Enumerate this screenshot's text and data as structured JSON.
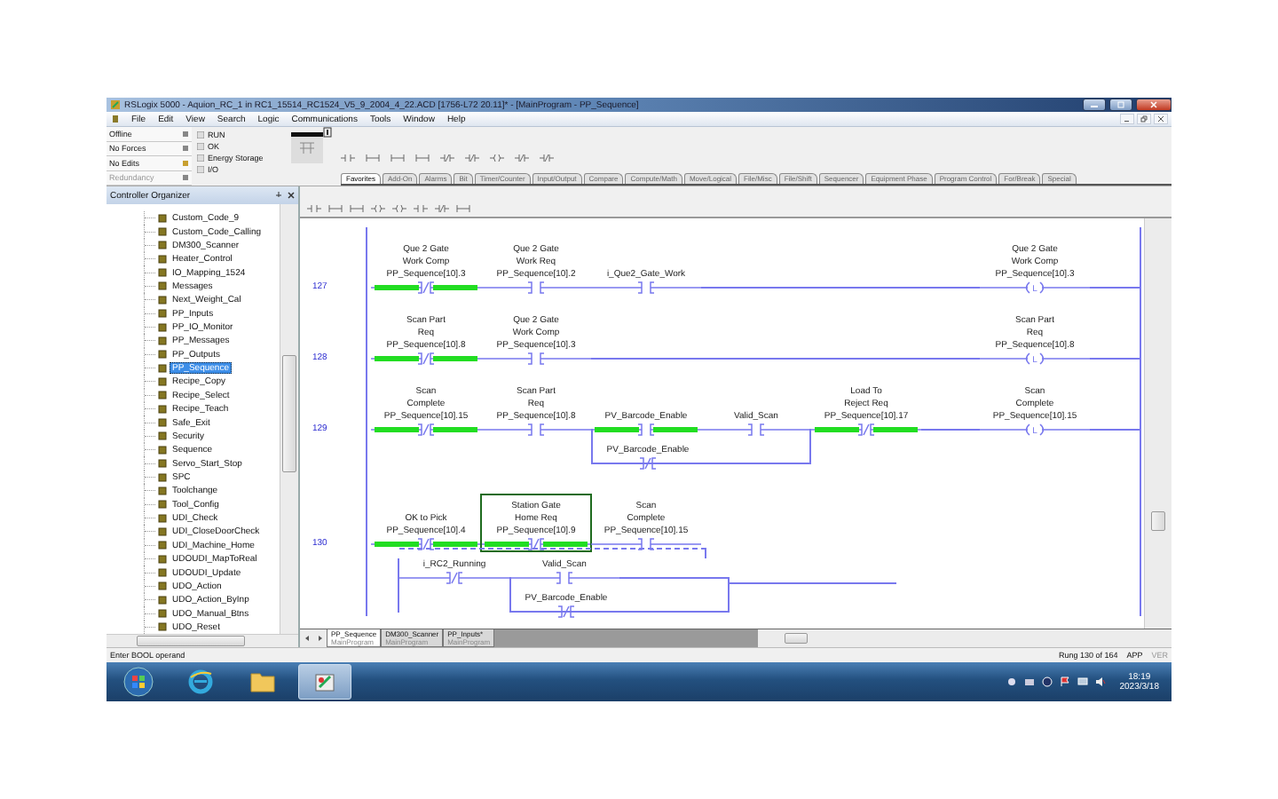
{
  "window": {
    "title": "RSLogix 5000 - Aquion_RC_1 in RC1_15514_RC1524_V5_9_2004_4_22.ACD [1756-L72 20.11]* - [MainProgram - PP_Sequence]"
  },
  "menu": [
    "File",
    "Edit",
    "View",
    "Search",
    "Logic",
    "Communications",
    "Tools",
    "Window",
    "Help"
  ],
  "controller_status": [
    {
      "label": "Offline",
      "disabled": false
    },
    {
      "label": "No Forces",
      "disabled": false
    },
    {
      "label": "No Edits",
      "disabled": false
    },
    {
      "label": "Redundancy",
      "disabled": true
    }
  ],
  "indicators": [
    "RUN",
    "OK",
    "Energy Storage",
    "I/O"
  ],
  "instruction_tabs": [
    {
      "label": "Favorites",
      "selected": true
    },
    {
      "label": "Add-On",
      "selected": false
    },
    {
      "label": "Alarms",
      "selected": false
    },
    {
      "label": "Bit",
      "selected": false
    },
    {
      "label": "Timer/Counter",
      "selected": false
    },
    {
      "label": "Input/Output",
      "selected": false
    },
    {
      "label": "Compare",
      "selected": false
    },
    {
      "label": "Compute/Math",
      "selected": false
    },
    {
      "label": "Move/Logical",
      "selected": false
    },
    {
      "label": "File/Misc",
      "selected": false
    },
    {
      "label": "File/Shift",
      "selected": false
    },
    {
      "label": "Sequencer",
      "selected": false
    },
    {
      "label": "Equipment Phase",
      "selected": false
    },
    {
      "label": "Program Control",
      "selected": false
    },
    {
      "label": "For/Break",
      "selected": false
    },
    {
      "label": "Special",
      "selected": false
    }
  ],
  "organizer": {
    "title": "Controller Organizer",
    "items": [
      {
        "label": "Custom_Code_9",
        "selected": false
      },
      {
        "label": "Custom_Code_Calling",
        "selected": false
      },
      {
        "label": "DM300_Scanner",
        "selected": false
      },
      {
        "label": "Heater_Control",
        "selected": false
      },
      {
        "label": "IO_Mapping_1524",
        "selected": false
      },
      {
        "label": "Messages",
        "selected": false
      },
      {
        "label": "Next_Weight_Cal",
        "selected": false
      },
      {
        "label": "PP_Inputs",
        "selected": false
      },
      {
        "label": "PP_IO_Monitor",
        "selected": false
      },
      {
        "label": "PP_Messages",
        "selected": false
      },
      {
        "label": "PP_Outputs",
        "selected": false
      },
      {
        "label": "PP_Sequence",
        "selected": true
      },
      {
        "label": "Recipe_Copy",
        "selected": false
      },
      {
        "label": "Recipe_Select",
        "selected": false
      },
      {
        "label": "Recipe_Teach",
        "selected": false
      },
      {
        "label": "Safe_Exit",
        "selected": false
      },
      {
        "label": "Security",
        "selected": false
      },
      {
        "label": "Sequence",
        "selected": false
      },
      {
        "label": "Servo_Start_Stop",
        "selected": false
      },
      {
        "label": "SPC",
        "selected": false
      },
      {
        "label": "Toolchange",
        "selected": false
      },
      {
        "label": "Tool_Config",
        "selected": false
      },
      {
        "label": "UDI_Check",
        "selected": false
      },
      {
        "label": "UDI_CloseDoorCheck",
        "selected": false
      },
      {
        "label": "UDI_Machine_Home",
        "selected": false
      },
      {
        "label": "UDOUDI_MapToReal",
        "selected": false
      },
      {
        "label": "UDOUDI_Update",
        "selected": false
      },
      {
        "label": "UDO_Action",
        "selected": false
      },
      {
        "label": "UDO_Action_ByInp",
        "selected": false
      },
      {
        "label": "UDO_Manual_Btns",
        "selected": false
      },
      {
        "label": "UDO_Reset",
        "selected": false
      }
    ]
  },
  "rungs": [
    {
      "number": "127",
      "instructions": [
        {
          "kind": "xio",
          "description": [
            "Que 2 Gate",
            "Work Comp"
          ],
          "tag": "PP_Sequence[10].3",
          "energized": true,
          "selected": false
        },
        {
          "kind": "xic",
          "description": [
            "Que 2 Gate",
            "Work Req"
          ],
          "tag": "PP_Sequence[10].2",
          "energized": false,
          "selected": false
        },
        {
          "kind": "xic",
          "tag": "i_Que2_Gate_Work",
          "energized": false,
          "selected": false
        }
      ],
      "coil": {
        "letter": "L",
        "description": [
          "Que 2 Gate",
          "Work Comp"
        ],
        "tag": "PP_Sequence[10].3"
      }
    },
    {
      "number": "128",
      "instructions": [
        {
          "kind": "xio",
          "description": [
            "Scan Part",
            "Req"
          ],
          "tag": "PP_Sequence[10].8",
          "energized": true,
          "selected": false
        },
        {
          "kind": "xic",
          "description": [
            "Que 2 Gate",
            "Work Comp"
          ],
          "tag": "PP_Sequence[10].3",
          "energized": false,
          "selected": false
        }
      ],
      "coil": {
        "letter": "L",
        "description": [
          "Scan Part",
          "Req"
        ],
        "tag": "PP_Sequence[10].8"
      }
    },
    {
      "number": "129",
      "instructions": [
        {
          "kind": "xio",
          "description": [
            "Scan",
            "Complete"
          ],
          "tag": "PP_Sequence[10].15",
          "energized": true,
          "selected": false
        },
        {
          "kind": "xic",
          "description": [
            "Scan Part",
            "Req"
          ],
          "tag": "PP_Sequence[10].8",
          "energized": false,
          "selected": false
        },
        {
          "kind": "branch",
          "legs": [
            [
              {
                "kind": "xic",
                "tag": "PV_Barcode_Enable",
                "energized": true,
                "selected": false
              },
              {
                "kind": "xic",
                "tag": "Valid_Scan",
                "energized": false,
                "selected": false
              }
            ],
            [
              {
                "kind": "xio",
                "tag": "PV_Barcode_Enable",
                "energized": false,
                "selected": false
              }
            ]
          ]
        },
        {
          "kind": "xio",
          "description": [
            "Load To",
            "Reject Req"
          ],
          "tag": "PP_Sequence[10].17",
          "energized": true,
          "selected": false
        }
      ],
      "coil": {
        "letter": "L",
        "description": [
          "Scan",
          "Complete"
        ],
        "tag": "PP_Sequence[10].15"
      }
    },
    {
      "number": "130",
      "instructions": [
        {
          "kind": "xio",
          "description": [
            "OK to Pick"
          ],
          "tag": "PP_Sequence[10].4",
          "energized": true,
          "selected": false
        },
        {
          "kind": "xio",
          "description": [
            "Station Gate",
            "Home Req"
          ],
          "tag": "PP_Sequence[10].9",
          "energized": true,
          "selected": true
        },
        {
          "kind": "xic",
          "description": [
            "Scan",
            "Complete"
          ],
          "tag": "PP_Sequence[10].15",
          "energized": false,
          "selected": false
        }
      ],
      "continuation": [
        {
          "kind": "xio",
          "tag": "i_RC2_Running",
          "energized": false,
          "selected": false
        },
        {
          "kind": "branch",
          "legs": [
            [
              {
                "kind": "xic",
                "tag": "Valid_Scan",
                "energized": false,
                "selected": false
              }
            ],
            [
              {
                "kind": "xio",
                "tag": "PV_Barcode_Enable",
                "energized": false,
                "selected": false
              }
            ]
          ]
        }
      ]
    }
  ],
  "program_tabs": [
    {
      "label": "PP_Sequence",
      "sublabel": "MainProgram",
      "selected": true
    },
    {
      "label": "DM300_Scanner",
      "sublabel": "MainProgram",
      "selected": false
    },
    {
      "label": "PP_Inputs*",
      "sublabel": "MainProgram",
      "selected": false
    }
  ],
  "status_bar": {
    "message": "Enter BOOL operand",
    "rung": "Rung 130 of 164",
    "mode": "APP",
    "version": "VER"
  },
  "taskbar": {
    "time": "18:19",
    "date": "2023/3/18"
  }
}
